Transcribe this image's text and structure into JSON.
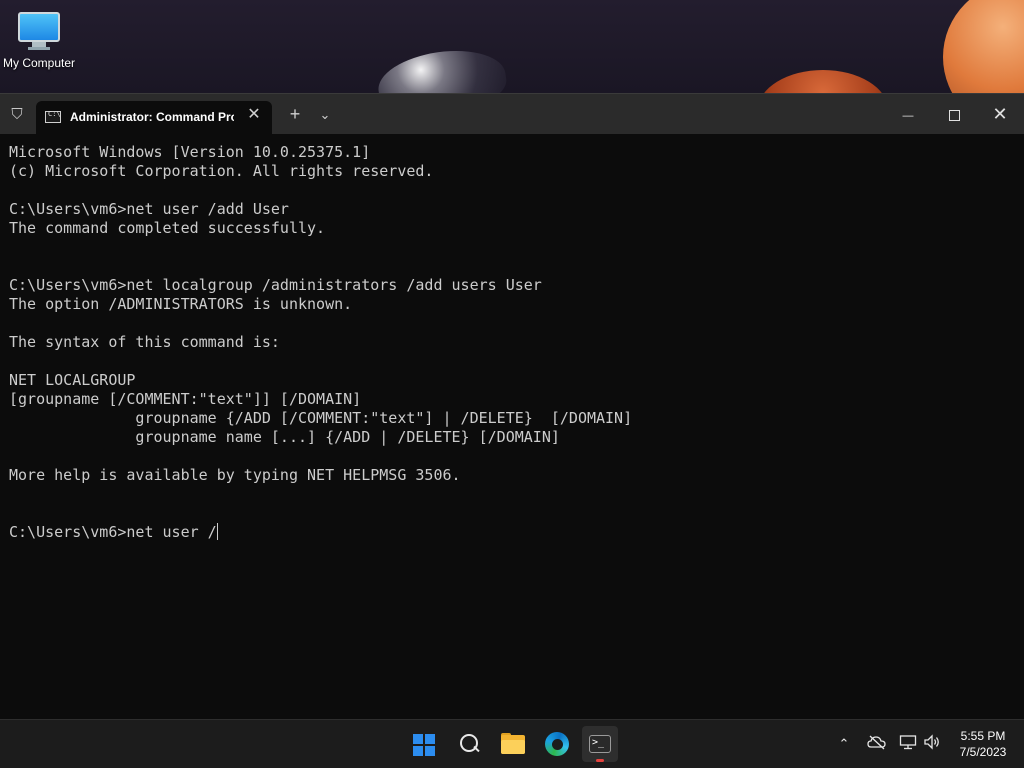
{
  "desktop": {
    "icons": [
      {
        "label": "My Computer",
        "icon": "monitor-icon"
      }
    ]
  },
  "terminal": {
    "tab_title": "Administrator:  Command Prompt",
    "tab_icon": "cmd-icon",
    "tab_icon_text": "C:\\",
    "new_tab_glyph": "+",
    "dropdown_glyph": "⌄",
    "close_tab_glyph": "✕",
    "window_controls": {
      "minimize": "—",
      "close": "✕"
    },
    "lines": [
      "Microsoft Windows [Version 10.0.25375.1]",
      "(c) Microsoft Corporation. All rights reserved.",
      "",
      "C:\\Users\\vm6>net user /add User",
      "The command completed successfully.",
      "",
      "",
      "C:\\Users\\vm6>net localgroup /administrators /add users User",
      "The option /ADMINISTRATORS is unknown.",
      "",
      "The syntax of this command is:",
      "",
      "NET LOCALGROUP",
      "[groupname [/COMMENT:\"text\"]] [/DOMAIN]",
      "              groupname {/ADD [/COMMENT:\"text\"] | /DELETE}  [/DOMAIN]",
      "              groupname name [...] {/ADD | /DELETE} [/DOMAIN]",
      "",
      "More help is available by typing NET HELPMSG 3506.",
      "",
      "",
      "C:\\Users\\vm6>net user /"
    ]
  },
  "taskbar": {
    "apps": [
      "start-icon",
      "search-icon",
      "file-explorer-icon",
      "edge-icon",
      "terminal-icon"
    ],
    "active_app": "terminal-icon",
    "tray": [
      "chevron-up-icon",
      "onedrive-offline-icon",
      "network-icon",
      "volume-icon"
    ],
    "clock": {
      "time": "5:55 PM",
      "date": "7/5/2023"
    }
  },
  "colors": {
    "terminal_bg": "#0c0c0c",
    "titlebar_bg": "#2b2b2b",
    "text": "#cccccc",
    "taskbar_bg": "#1c1c1c",
    "accent_red": "#e5423d"
  }
}
